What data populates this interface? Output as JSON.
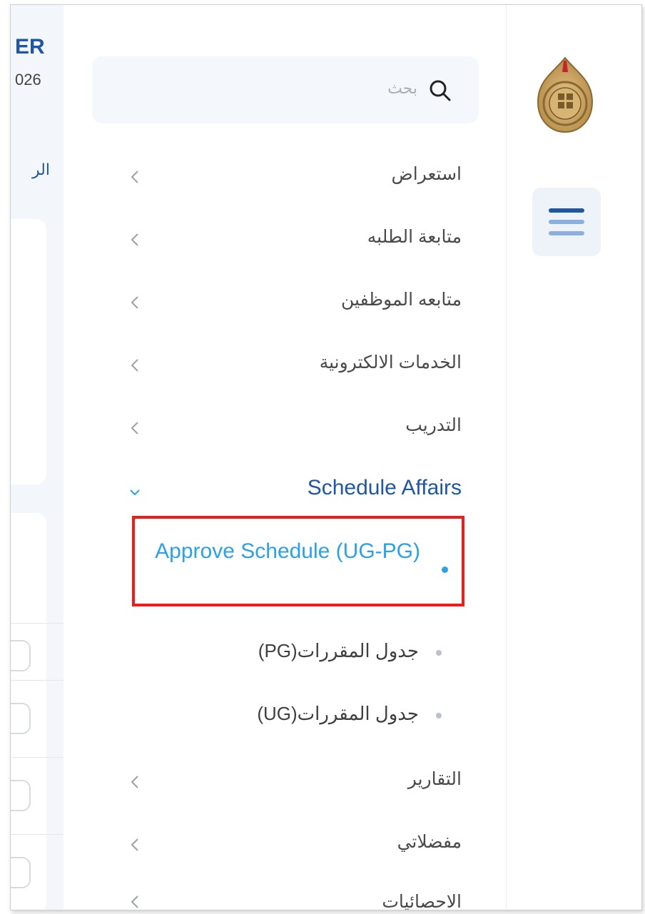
{
  "background": {
    "title_fragment": "ER",
    "year_fragment": "026",
    "tab_fragment": "الر"
  },
  "search": {
    "placeholder": "بحث"
  },
  "menu": {
    "items_top": [
      {
        "label": "استعراض"
      },
      {
        "label": "متابعة الطلبه"
      },
      {
        "label": "متابعه الموظفين"
      },
      {
        "label": "الخدمات الالكترونية"
      },
      {
        "label": "التدريب"
      }
    ],
    "group": {
      "label": "Schedule Affairs",
      "expanded": true,
      "children": [
        {
          "label": "Approve Schedule (UG-PG)",
          "active": true
        },
        {
          "label": "جدول المقررات(PG)"
        },
        {
          "label": "جدول المقررات(UG)"
        }
      ]
    },
    "items_bottom": [
      {
        "label": "التقارير"
      },
      {
        "label": "مفضلاتي"
      },
      {
        "label": "الاحصائيات"
      }
    ]
  },
  "colors": {
    "brand": "#1f57a2",
    "active": "#2aa1e8",
    "highlight_border": "#ef1c1c",
    "text": "#4a4a4a"
  },
  "icons": {
    "search": "search-icon",
    "chevron": "chevron-left-icon",
    "expanded": "chevron-down-icon",
    "menu_toggle": "hamburger-menu-icon",
    "logo": "university-logo"
  }
}
